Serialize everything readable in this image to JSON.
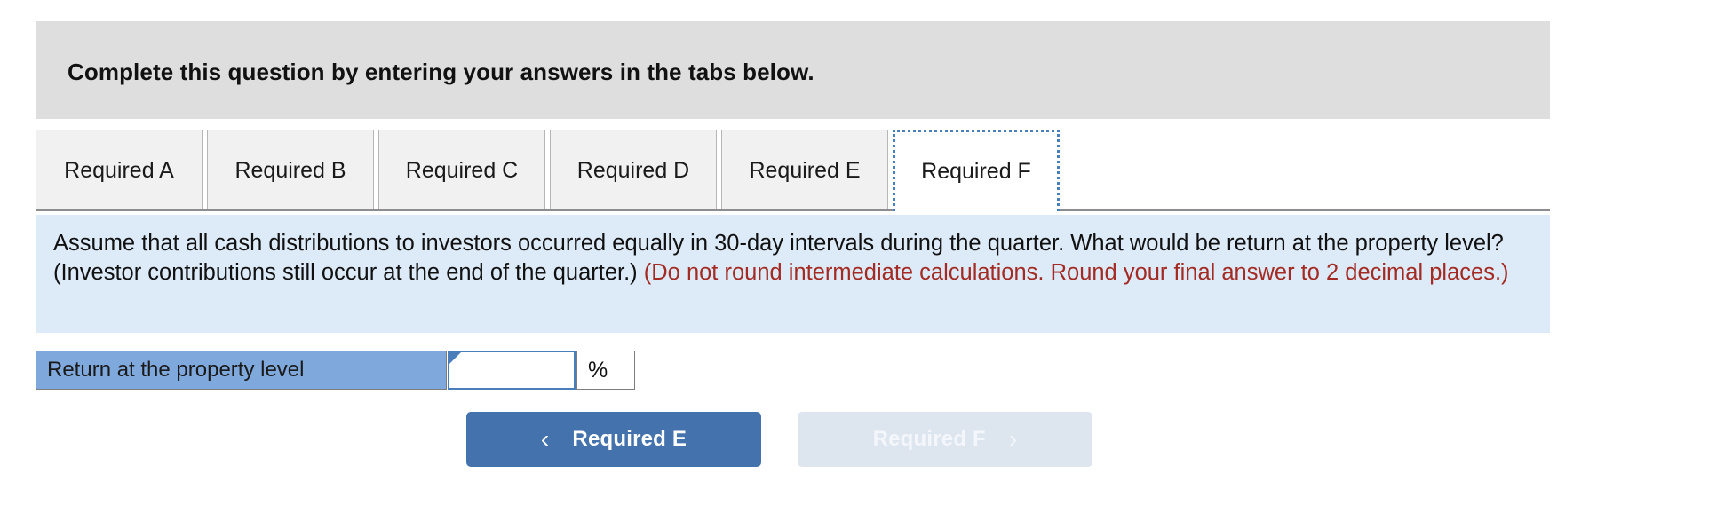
{
  "instruction": {
    "text": "Complete this question by entering your answers in the tabs below."
  },
  "tabs": {
    "items": [
      {
        "label": "Required A",
        "active": false
      },
      {
        "label": "Required B",
        "active": false
      },
      {
        "label": "Required C",
        "active": false
      },
      {
        "label": "Required D",
        "active": false
      },
      {
        "label": "Required E",
        "active": false
      },
      {
        "label": "Required F",
        "active": true
      }
    ]
  },
  "question": {
    "body": "Assume that all cash distributions to investors occurred equally in 30-day intervals during the quarter. What would be return at the property level? (Investor contributions still occur at the end of the quarter.) ",
    "note": "(Do not round intermediate calculations. Round your final answer to 2 decimal places.)"
  },
  "answer": {
    "label": "Return at the property level",
    "value": "",
    "placeholder": "",
    "unit": "%"
  },
  "navigation": {
    "prev_label": "Required E",
    "prev_icon": "chevron-left-icon",
    "prev_chevron": "‹",
    "next_label": "Required F",
    "next_icon": "chevron-right-icon",
    "next_chevron": "›",
    "next_disabled": true
  },
  "colors": {
    "banner_gray": "#dedede",
    "question_blue": "#ddeaf7",
    "label_blue": "#7fa9dd",
    "accent_blue": "#4a7ebb",
    "button_blue": "#4472ad",
    "button_disabled": "#dde5ef",
    "note_red": "#a32b24",
    "tab_gray": "#f1f1f1",
    "divider_gray": "#8d8d8d"
  }
}
